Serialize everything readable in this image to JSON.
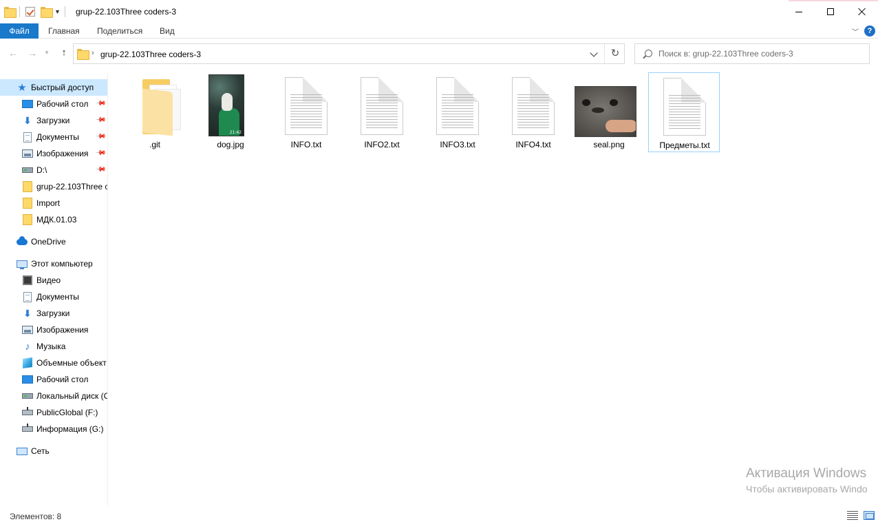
{
  "window": {
    "title": "grup-22.103Three coders-3",
    "minimize_label": "Minimize",
    "maximize_label": "Maximize",
    "close_label": "Close"
  },
  "ribbon": {
    "tabs": [
      "Файл",
      "Главная",
      "Поделиться",
      "Вид"
    ],
    "help_glyph": "?"
  },
  "address": {
    "path": "grup-22.103Three coders-3",
    "search_placeholder": "Поиск в: grup-22.103Three coders-3"
  },
  "nav": {
    "quick_access": {
      "label": "Быстрый доступ",
      "items": [
        {
          "label": "Рабочий стол",
          "icon": "desktop-icon",
          "pinned": true
        },
        {
          "label": "Загрузки",
          "icon": "downloads-icon",
          "pinned": true
        },
        {
          "label": "Документы",
          "icon": "documents-icon",
          "pinned": true
        },
        {
          "label": "Изображения",
          "icon": "pictures-icon",
          "pinned": true
        },
        {
          "label": "D:\\",
          "icon": "drive-icon",
          "pinned": true
        },
        {
          "label": "grup-22.103Three c",
          "icon": "folder-icon",
          "pinned": false
        },
        {
          "label": "Import",
          "icon": "folder-icon",
          "pinned": false
        },
        {
          "label": "МДК.01.03",
          "icon": "folder-icon",
          "pinned": false
        }
      ]
    },
    "onedrive": {
      "label": "OneDrive"
    },
    "this_pc": {
      "label": "Этот компьютер",
      "items": [
        {
          "label": "Видео",
          "icon": "video-icon"
        },
        {
          "label": "Документы",
          "icon": "documents-icon"
        },
        {
          "label": "Загрузки",
          "icon": "downloads-icon"
        },
        {
          "label": "Изображения",
          "icon": "pictures-icon"
        },
        {
          "label": "Музыка",
          "icon": "music-icon"
        },
        {
          "label": "Объемные объект",
          "icon": "3d-objects-icon"
        },
        {
          "label": "Рабочий стол",
          "icon": "desktop-icon"
        },
        {
          "label": "Локальный диск (C",
          "icon": "local-disk-icon"
        },
        {
          "label": "PublicGlobal (F:)",
          "icon": "network-drive-icon"
        },
        {
          "label": "Информация (G:)",
          "icon": "network-drive-icon"
        }
      ]
    },
    "network": {
      "label": "Сеть"
    }
  },
  "files": [
    {
      "name": ".git",
      "kind": "folder"
    },
    {
      "name": "dog.jpg",
      "kind": "image",
      "thumb_time": "21:42"
    },
    {
      "name": "INFO.txt",
      "kind": "text"
    },
    {
      "name": "INFO2.txt",
      "kind": "text"
    },
    {
      "name": "INFO3.txt",
      "kind": "text"
    },
    {
      "name": "INFO4.txt",
      "kind": "text"
    },
    {
      "name": "seal.png",
      "kind": "image"
    },
    {
      "name": "Предметы.txt",
      "kind": "text",
      "selected": true
    }
  ],
  "watermark": {
    "title": "Активация Windows",
    "subtitle": "Чтобы активировать Windo"
  },
  "status": {
    "item_count": "Элементов: 8"
  },
  "colors": {
    "accent": "#1979ca",
    "selection": "#cce8ff",
    "tile_selection_border": "#99d1ff"
  }
}
